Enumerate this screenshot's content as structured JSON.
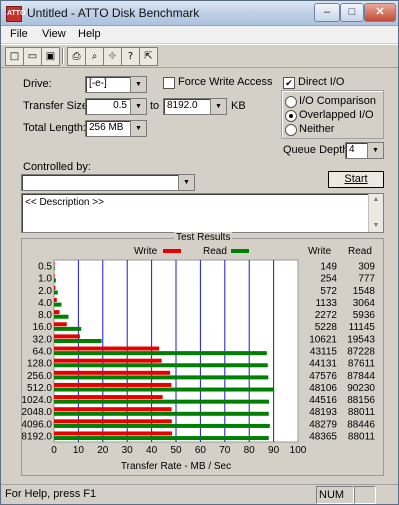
{
  "window": {
    "app_icon_text": "ATTO",
    "title": "Untitled - ATTO Disk Benchmark",
    "min": "–",
    "max": "□",
    "close": "✕"
  },
  "menu": [
    "File",
    "View",
    "Help"
  ],
  "toolbar": {
    "new": "□",
    "open": "▭",
    "save": "▣",
    "print": "⎙",
    "search": "⌕",
    "move": "✥",
    "help": "?",
    "context_help": "⇱"
  },
  "drive": {
    "label": "Drive:",
    "value": "[-e-]"
  },
  "force_write": {
    "label": "Force Write Access",
    "checked": false
  },
  "direct_io": {
    "label": "Direct I/O",
    "checked": true,
    "mark": "✔"
  },
  "transfer_size": {
    "label": "Transfer Size:",
    "from": "0.5",
    "to_label": "to",
    "to": "8192.0",
    "unit": "KB"
  },
  "total_length": {
    "label": "Total Length:",
    "value": "256 MB"
  },
  "io_mode": {
    "options": [
      "I/O Comparison",
      "Overlapped I/O",
      "Neither"
    ],
    "selected_index": 1
  },
  "queue_depth": {
    "label": "Queue Depth:",
    "value": "4"
  },
  "controlled_by": {
    "label": "Controlled by:",
    "value": ""
  },
  "start": {
    "label": "Start"
  },
  "description": {
    "text": "<< Description >>"
  },
  "results": {
    "title": "Test Results",
    "legend_write": "Write",
    "legend_read": "Read",
    "col_write": "Write",
    "col_read": "Read"
  },
  "colors": {
    "write": "#e80000",
    "read": "#008000",
    "grid": "#1a1ad6"
  },
  "chart_data": {
    "type": "bar",
    "orientation": "horizontal",
    "title": "Test Results",
    "xlabel": "Transfer Rate - MB / Sec",
    "xlim": [
      0,
      100
    ],
    "xticks": [
      "0",
      "10",
      "20",
      "30",
      "40",
      "50",
      "60",
      "70",
      "80",
      "90",
      "100"
    ],
    "categories": [
      "0.5",
      "1.0",
      "2.0",
      "4.0",
      "8.0",
      "16.0",
      "32.0",
      "64.0",
      "128.0",
      "256.0",
      "512.0",
      "1024.0",
      "2048.0",
      "4096.0",
      "8192.0"
    ],
    "series": [
      {
        "name": "Write",
        "values": [
          0.149,
          0.254,
          0.572,
          1.133,
          2.272,
          5.228,
          10.621,
          43.115,
          44.131,
          47.576,
          48.106,
          44.516,
          48.193,
          48.279,
          48.365
        ]
      },
      {
        "name": "Read",
        "values": [
          0.309,
          0.777,
          1.548,
          3.064,
          5.936,
          11.145,
          19.543,
          87.228,
          87.611,
          87.844,
          90.23,
          88.156,
          88.011,
          88.446,
          88.011
        ]
      }
    ],
    "write_text": [
      "149",
      "254",
      "572",
      "1133",
      "2272",
      "5228",
      "10621",
      "43115",
      "44131",
      "47576",
      "48106",
      "44516",
      "48193",
      "48279",
      "48365"
    ],
    "read_text": [
      "309",
      "777",
      "1548",
      "3064",
      "5936",
      "11145",
      "19543",
      "87228",
      "87611",
      "87844",
      "90230",
      "88156",
      "88011",
      "88446",
      "88011"
    ]
  },
  "status": {
    "text": "For Help, press F1",
    "num": "NUM"
  }
}
